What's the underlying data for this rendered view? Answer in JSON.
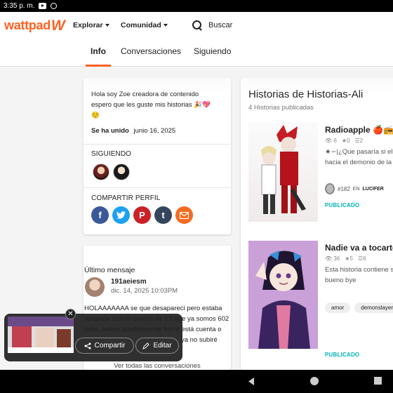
{
  "status_bar": {
    "time": "3:35 p. m.",
    "icons": [
      "youtube-icon",
      "game-controller-icon"
    ]
  },
  "header": {
    "logo_text": "wattpad",
    "logo_mark": "W",
    "nav": [
      {
        "label": "Explorar"
      },
      {
        "label": "Comunidad"
      }
    ],
    "search_label": "Buscar"
  },
  "tabs": [
    {
      "label": "Info",
      "active": true
    },
    {
      "label": "Conversaciones",
      "active": false
    },
    {
      "label": "Siguiendo",
      "active": false
    }
  ],
  "about": {
    "bio": [
      "Hola soy Zoe creadora de contenido",
      "espero que les guste mis historias 🎉💖",
      "☺️"
    ],
    "joined_label": "Se ha unido",
    "joined_date": "junio 16, 2025",
    "following_label": "SIGUIENDO",
    "share_label": "COMPARTIR PERFIL",
    "share_icons": [
      "facebook-icon",
      "twitter-icon",
      "pinterest-icon",
      "tumblr-icon",
      "email-icon"
    ]
  },
  "last_message": {
    "heading": "Último mensaje",
    "username": "191aeiesm",
    "date": "dic. 14, 2025 10:03PM",
    "lines": [
      "HOLAAAAAAA se que desapareci pero estaba",
      "ocupada con mi cuenta de YT que ya somos 602",
      "subs, bueno posiblemente borre está cuenta o",
      "ya no subiré"
    ],
    "view_all": "Ver todas las conversaciones"
  },
  "stories_panel": {
    "title": "Historias de Historias-Ali",
    "count": "4 Historias publicadas",
    "stories": [
      {
        "title": "Radioapple 🍎📻",
        "reads": "6",
        "votes": "0",
        "parts": "2",
        "desc": [
          "★∽|¿Que pasaría si el",
          "hacia el demonio de la"
        ],
        "rank": "#182",
        "rank_label": "EN",
        "rank_tag": "LUCIFER",
        "status": "PUBLICADO"
      },
      {
        "title": "Nadie va a tocarte",
        "reads": "36",
        "votes": "5",
        "parts": "6",
        "desc": [
          "Esta historia contiene s",
          "bueno bye"
        ],
        "tags": [
          "amor",
          "demonslayer"
        ],
        "status": "PUBLICADO"
      }
    ]
  },
  "pip": {
    "share_label": "Compartir",
    "edit_label": "Editar"
  },
  "colors": {
    "brand": "#ff6122",
    "published": "#00b2b2"
  }
}
